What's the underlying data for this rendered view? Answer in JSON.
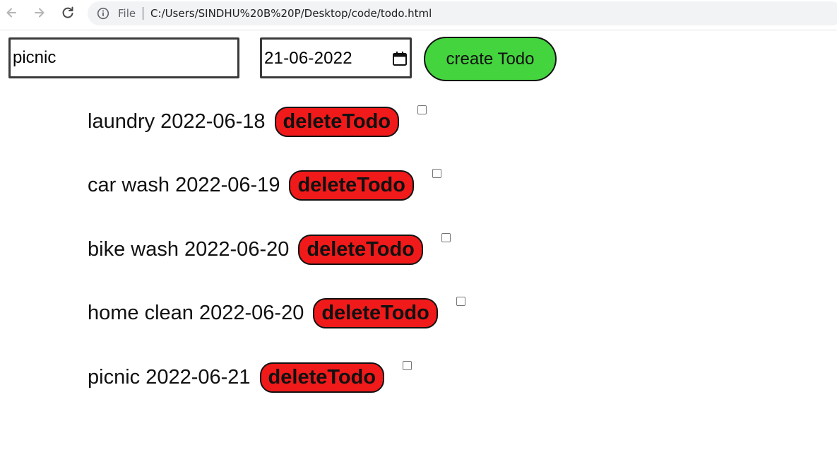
{
  "browser": {
    "scheme_label": "File",
    "url": "C:/Users/SINDHU%20B%20P/Desktop/code/todo.html"
  },
  "form": {
    "todo_value": "picnic",
    "date_value": "21-06-2022",
    "create_label": "create Todo"
  },
  "todos": [
    {
      "text": "laundry 2022-06-18",
      "delete_label": "deleteTodo",
      "checked": false
    },
    {
      "text": "car wash 2022-06-19",
      "delete_label": "deleteTodo",
      "checked": false
    },
    {
      "text": "bike wash 2022-06-20",
      "delete_label": "deleteTodo",
      "checked": false
    },
    {
      "text": "home clean 2022-06-20",
      "delete_label": "deleteTodo",
      "checked": false
    },
    {
      "text": "picnic 2022-06-21",
      "delete_label": "deleteTodo",
      "checked": false
    }
  ],
  "colors": {
    "create_button": "#44d43e",
    "delete_button": "#f01a1a"
  },
  "icons": {
    "back": "arrow-left-icon",
    "forward": "arrow-right-icon",
    "reload": "reload-icon",
    "info": "info-icon",
    "calendar": "calendar-icon"
  }
}
